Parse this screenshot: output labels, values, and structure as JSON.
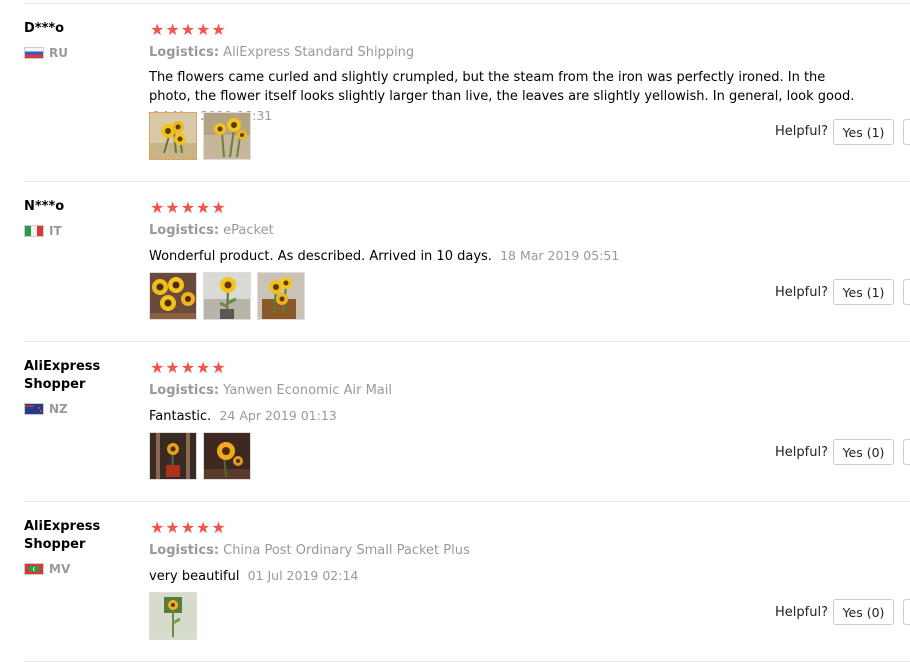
{
  "reviews": [
    {
      "user": "D***o",
      "country": "RU",
      "flag": "russia-flag",
      "stars": "★★★★★",
      "logistics_label": "Logistics:",
      "logistics": "AliExpress Standard Shipping",
      "text": "The flowers came curled and slightly crumpled, but the steam from the iron was perfectly ironed. In the photo, the flower itself looks slightly larger than live, the leaves are slightly yellowish. In general, look good.",
      "date": "14 Mar 2019 06:31",
      "helpful_label": "Helpful?",
      "yes_label": "Yes (1)"
    },
    {
      "user": "N***o",
      "country": "IT",
      "flag": "italy-flag",
      "stars": "★★★★★",
      "logistics_label": "Logistics:",
      "logistics": "ePacket",
      "text": "Wonderful product. As described. Arrived in 10 days.",
      "date": "18 Mar 2019 05:51",
      "helpful_label": "Helpful?",
      "yes_label": "Yes (1)"
    },
    {
      "user": "AliExpress Shopper",
      "country": "NZ",
      "flag": "new-zealand-flag",
      "stars": "★★★★★",
      "logistics_label": "Logistics:",
      "logistics": "Yanwen Economic Air Mail",
      "text": "Fantastic.",
      "date": "24 Apr 2019 01:13",
      "helpful_label": "Helpful?",
      "yes_label": "Yes (0)"
    },
    {
      "user": "AliExpress Shopper",
      "country": "MV",
      "flag": "maldives-flag",
      "stars": "★★★★★",
      "logistics_label": "Logistics:",
      "logistics": "China Post Ordinary Small Packet Plus",
      "text": "very beautiful",
      "date": "01 Jul 2019 02:14",
      "helpful_label": "Helpful?",
      "yes_label": "Yes (0)"
    }
  ],
  "colors": {
    "star": "#f05550",
    "muted_text": "#999999",
    "divider": "#e8e8e8",
    "active_thumb_border": "#e5a25a"
  }
}
